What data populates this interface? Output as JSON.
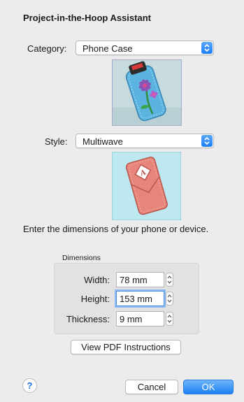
{
  "dialog": {
    "title": "Project-in-the-Hoop Assistant"
  },
  "category": {
    "label": "Category:",
    "selected": "Phone Case"
  },
  "style": {
    "label": "Style:",
    "selected": "Multiwave"
  },
  "instruction": "Enter the dimensions of your phone or device.",
  "dimensions": {
    "group_title": "Dimensions",
    "width_label": "Width:",
    "width_value": "78 mm",
    "height_label": "Height:",
    "height_value": "153 mm",
    "thickness_label": "Thickness:",
    "thickness_value": "9 mm"
  },
  "buttons": {
    "pdf": "View PDF Instructions",
    "cancel": "Cancel",
    "ok": "OK",
    "help": "?"
  },
  "colors": {
    "accent": "#1e82f6",
    "background": "#ececec"
  }
}
